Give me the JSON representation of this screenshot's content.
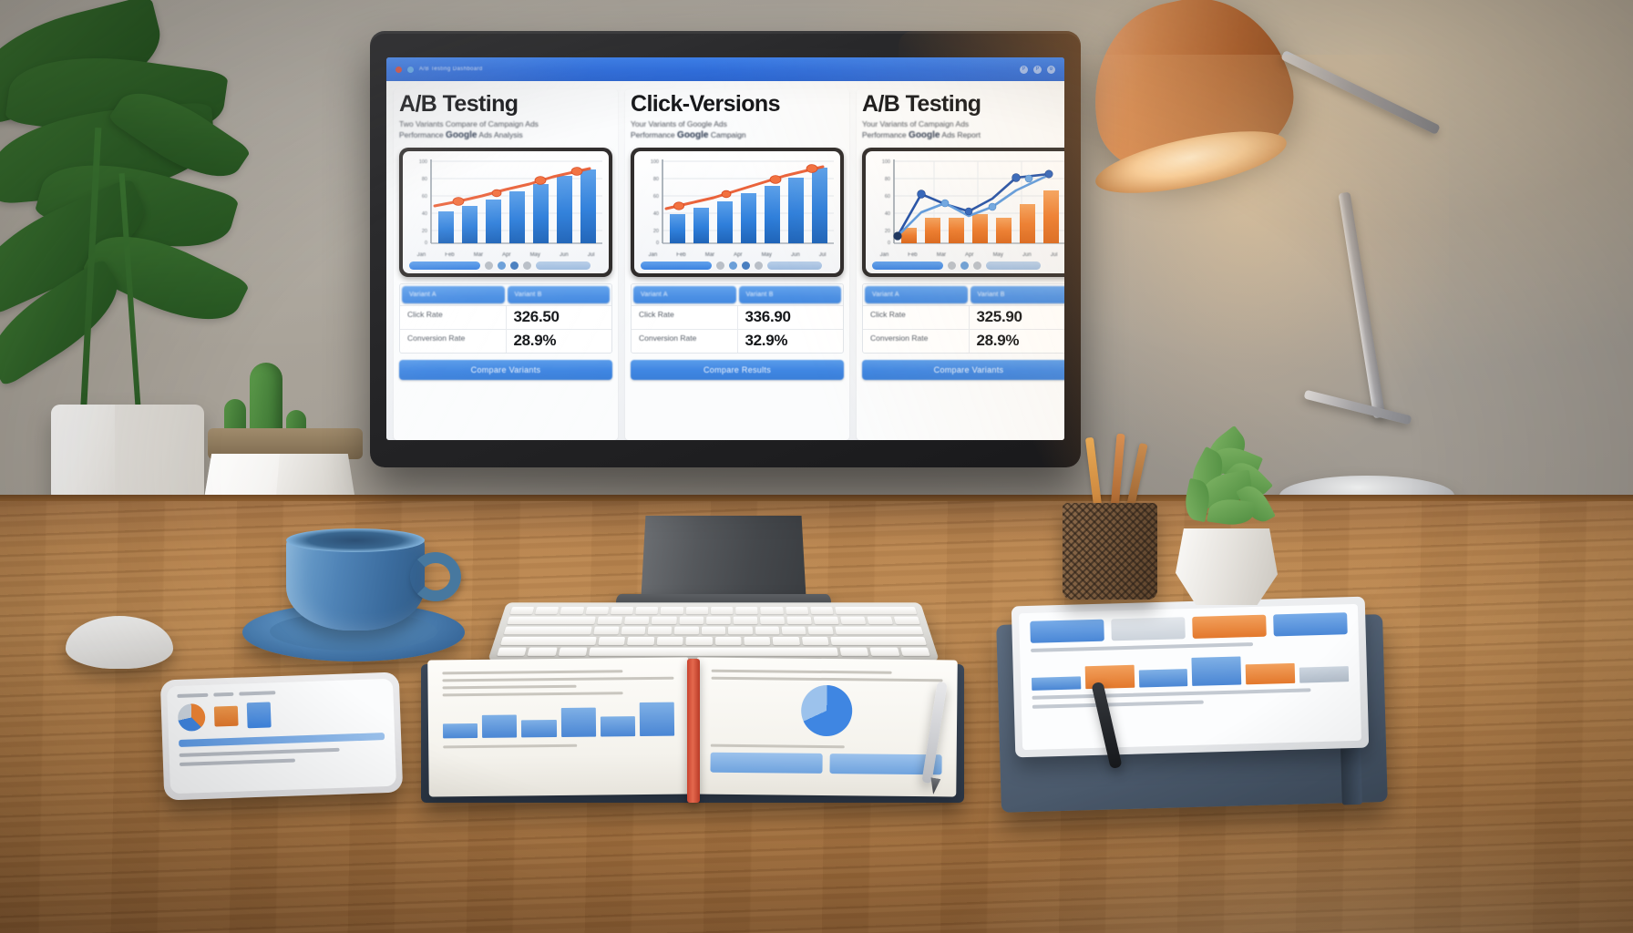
{
  "scene": {
    "description": "Desk workspace with monitor showing A/B testing dashboard",
    "desk_items": [
      "mouse",
      "coffee-cup",
      "saucer",
      "keyboard",
      "open-book",
      "smartphone",
      "tablet",
      "notebook",
      "pen-cup",
      "succulent",
      "desk-lamp",
      "potted-plants"
    ]
  },
  "browser": {
    "tab_label": "A/B Testing Dashboard",
    "dots": [
      "close",
      "minimize"
    ],
    "right_icons": [
      "profile-icon",
      "menu-icon",
      "settings-icon"
    ]
  },
  "cards": [
    {
      "title": "A/B Testing",
      "subtitle": "Two Variants Compare of Campaign Ads",
      "subtitle2_pre": "Performance",
      "subtitle2_brand": "Google",
      "subtitle2_post": "Ads Analysis",
      "chart": {
        "type": "bar-line",
        "bar_color": "#2f7fdb",
        "line_color": "#e8562a",
        "categories": [
          "Jan",
          "Feb",
          "Mar",
          "Apr",
          "May",
          "Jun",
          "Jul"
        ],
        "bar_values": [
          38,
          44,
          52,
          62,
          70,
          80,
          88
        ],
        "line_values": [
          44,
          50,
          58,
          68,
          76,
          86,
          94
        ],
        "ylim": [
          0,
          100
        ],
        "yticks": [
          "100",
          "80",
          "60",
          "40",
          "20",
          "0"
        ]
      },
      "controls": {
        "primary_pill": "filter-range",
        "dots": 4,
        "secondary_pill": "legend"
      },
      "table": {
        "headers": [
          "Variant A",
          "Variant B"
        ],
        "rows": [
          {
            "label": "Click Rate",
            "value": "326.50"
          },
          {
            "label": "Conversion Rate",
            "value": "28.9%"
          }
        ]
      },
      "cta": "Compare Variants"
    },
    {
      "title": "Click-Versions",
      "subtitle": "Your Variants of Google Ads",
      "subtitle2_pre": "Performance",
      "subtitle2_brand": "Google",
      "subtitle2_post": "Campaign",
      "chart": {
        "type": "bar-line",
        "bar_color": "#2f7fdb",
        "line_color": "#e8562a",
        "categories": [
          "Jan",
          "Feb",
          "Mar",
          "Apr",
          "May",
          "Jun",
          "Jul"
        ],
        "bar_values": [
          34,
          42,
          50,
          60,
          68,
          78,
          90
        ],
        "line_values": [
          40,
          48,
          56,
          66,
          75,
          85,
          96
        ],
        "ylim": [
          0,
          100
        ],
        "yticks": [
          "100",
          "80",
          "60",
          "40",
          "20",
          "0"
        ]
      },
      "controls": {
        "primary_pill": "filter-range",
        "dots": 4,
        "secondary_pill": "legend"
      },
      "table": {
        "headers": [
          "Variant A",
          "Variant B"
        ],
        "rows": [
          {
            "label": "Click Rate",
            "value": "336.90"
          },
          {
            "label": "Conversion Rate",
            "value": "32.9%"
          }
        ]
      },
      "cta": "Compare Results"
    },
    {
      "title": "A/B Testing",
      "subtitle": "Your Variants of Campaign Ads",
      "subtitle2_pre": "Performance",
      "subtitle2_brand": "Google",
      "subtitle2_post": "Ads Report",
      "chart": {
        "type": "bar-line",
        "bar_color": "#ec7a2c",
        "line_color": "#1f4fa8",
        "line_color2": "#5b9ae0",
        "categories": [
          "Jan",
          "Feb",
          "Mar",
          "Apr",
          "May",
          "Jun",
          "Jul"
        ],
        "bar_values": [
          18,
          30,
          30,
          34,
          30,
          46,
          62
        ],
        "line_values": [
          8,
          58,
          46,
          38,
          52,
          74,
          80
        ],
        "line2_values": [
          8,
          40,
          50,
          34,
          44,
          60,
          78
        ],
        "ylim": [
          0,
          100
        ],
        "yticks": [
          "100",
          "80",
          "60",
          "40",
          "20",
          "0"
        ]
      },
      "controls": {
        "primary_pill": "filter-range",
        "dots": 3,
        "secondary_pill": "legend"
      },
      "table": {
        "headers": [
          "Variant A",
          "Variant B"
        ],
        "rows": [
          {
            "label": "Click Rate",
            "value": "325.90"
          },
          {
            "label": "Conversion Rate",
            "value": "28.9%"
          }
        ]
      },
      "cta": "Compare Variants"
    }
  ],
  "colors": {
    "accent_blue": "#3f86e2",
    "bar_blue": "#2f7fdb",
    "line_orange": "#e8562a",
    "bar_orange": "#ec7a2c",
    "line_navy": "#1f4fa8",
    "desk_wood": "#b9854f",
    "lamp_copper": "#c5793e"
  }
}
